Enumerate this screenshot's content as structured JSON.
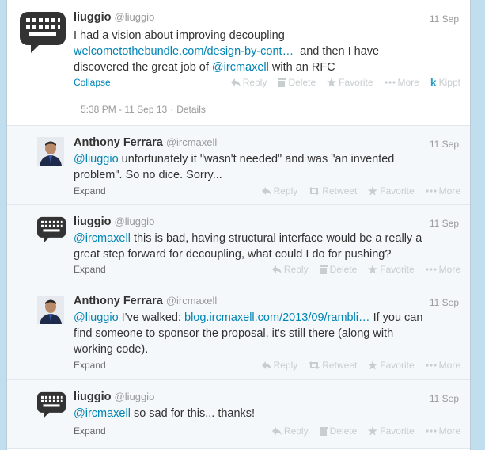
{
  "main_tweet": {
    "name": "liuggio",
    "handle": "@liuggio",
    "time": "11 Sep",
    "text_line1": "I had a vision about improving decoupling",
    "link": "welcometothebundle.com/design-by-cont…",
    "text_line2_rest": "and then I have",
    "text_line3_pre": "discovered the great job of",
    "mention": "@ircmaxell",
    "text_line3_post": "with an RFC",
    "collapse": "Collapse",
    "actions": {
      "reply": "Reply",
      "delete": "Delete",
      "favorite": "Favorite",
      "more": "More",
      "kippt": "Kippt"
    },
    "timestamp": "5:38 PM - 11 Sep 13",
    "details": "Details"
  },
  "replies": [
    {
      "name": "Anthony Ferrara",
      "handle": "@ircmaxell",
      "time": "11 Sep",
      "mention": "@liuggio",
      "text_a": "unfortunately it \"wasn't needed\" and was \"an invented",
      "text_b": "problem\". So no dice. Sorry...",
      "expand": "Expand",
      "actions": {
        "reply": "Reply",
        "retweet": "Retweet",
        "favorite": "Favorite",
        "more": "More"
      }
    },
    {
      "name": "liuggio",
      "handle": "@liuggio",
      "time": "11 Sep",
      "mention": "@ircmaxell",
      "text_a": "this is bad, having structural interface would be a really a",
      "text_b": "great step forward for decoupling, what could I do for pushing?",
      "expand": "Expand",
      "actions": {
        "reply": "Reply",
        "delete": "Delete",
        "favorite": "Favorite",
        "more": "More"
      }
    },
    {
      "name": "Anthony Ferrara",
      "handle": "@ircmaxell",
      "time": "11 Sep",
      "mention": "@liuggio",
      "text_a": "I've walked:",
      "link": "blog.ircmaxell.com/2013/09/rambli…",
      "text_a2": "If you can",
      "text_b": "find someone to sponsor the proposal, it's still there (along with",
      "text_c": "working code).",
      "expand": "Expand",
      "actions": {
        "reply": "Reply",
        "retweet": "Retweet",
        "favorite": "Favorite",
        "more": "More"
      }
    },
    {
      "name": "liuggio",
      "handle": "@liuggio",
      "time": "11 Sep",
      "mention": "@ircmaxell",
      "text_a": "so sad for this... thanks!",
      "expand": "Expand",
      "actions": {
        "reply": "Reply",
        "delete": "Delete",
        "favorite": "Favorite",
        "more": "More"
      }
    }
  ],
  "colors": {
    "link": "#0084b4",
    "background": "#c0deed",
    "muted": "#999999",
    "action": "#c8cdd0"
  }
}
